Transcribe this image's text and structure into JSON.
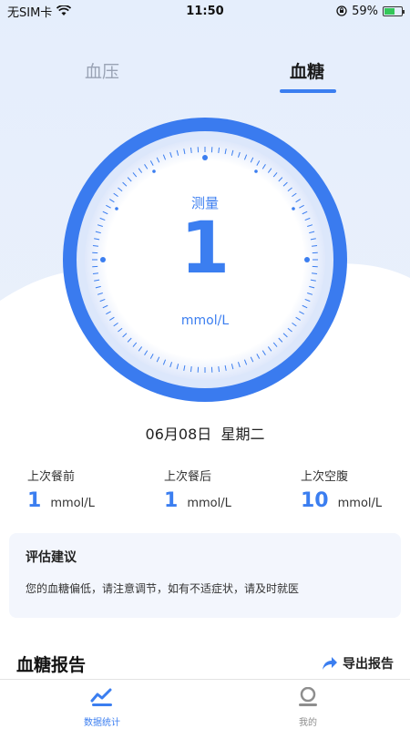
{
  "status_bar": {
    "carrier": "无SIM卡",
    "time": "11:50",
    "battery_percent": "59%",
    "battery_level": 0.59,
    "icons": [
      "wifi-icon",
      "orientation-lock-icon",
      "battery-icon"
    ]
  },
  "tabs": [
    {
      "label": "血压",
      "active": false
    },
    {
      "label": "血糖",
      "active": true
    }
  ],
  "gauge": {
    "label": "测量",
    "value": "1",
    "unit": "mmol/L"
  },
  "date": {
    "text": "06月08日  星期二"
  },
  "stats": [
    {
      "title": "上次餐前",
      "value": "1",
      "unit": "mmol/L"
    },
    {
      "title": "上次餐后",
      "value": "1",
      "unit": "mmol/L"
    },
    {
      "title": "上次空腹",
      "value": "10",
      "unit": "mmol/L"
    }
  ],
  "advice": {
    "title": "评估建议",
    "text": "您的血糖偏低，请注意调节，如有不适症状，请及时就医"
  },
  "report": {
    "title": "血糖报告",
    "export_label": "导出报告",
    "export_icon": "share-arrow-icon"
  },
  "bottom_nav": [
    {
      "label": "数据统计",
      "icon": "chart-line-icon",
      "active": true
    },
    {
      "label": "我的",
      "icon": "profile-icon",
      "active": false
    }
  ],
  "colors": {
    "accent": "#3b7ef0",
    "ring_outer": "#3a7bef",
    "background_top": "#e5eefc"
  }
}
